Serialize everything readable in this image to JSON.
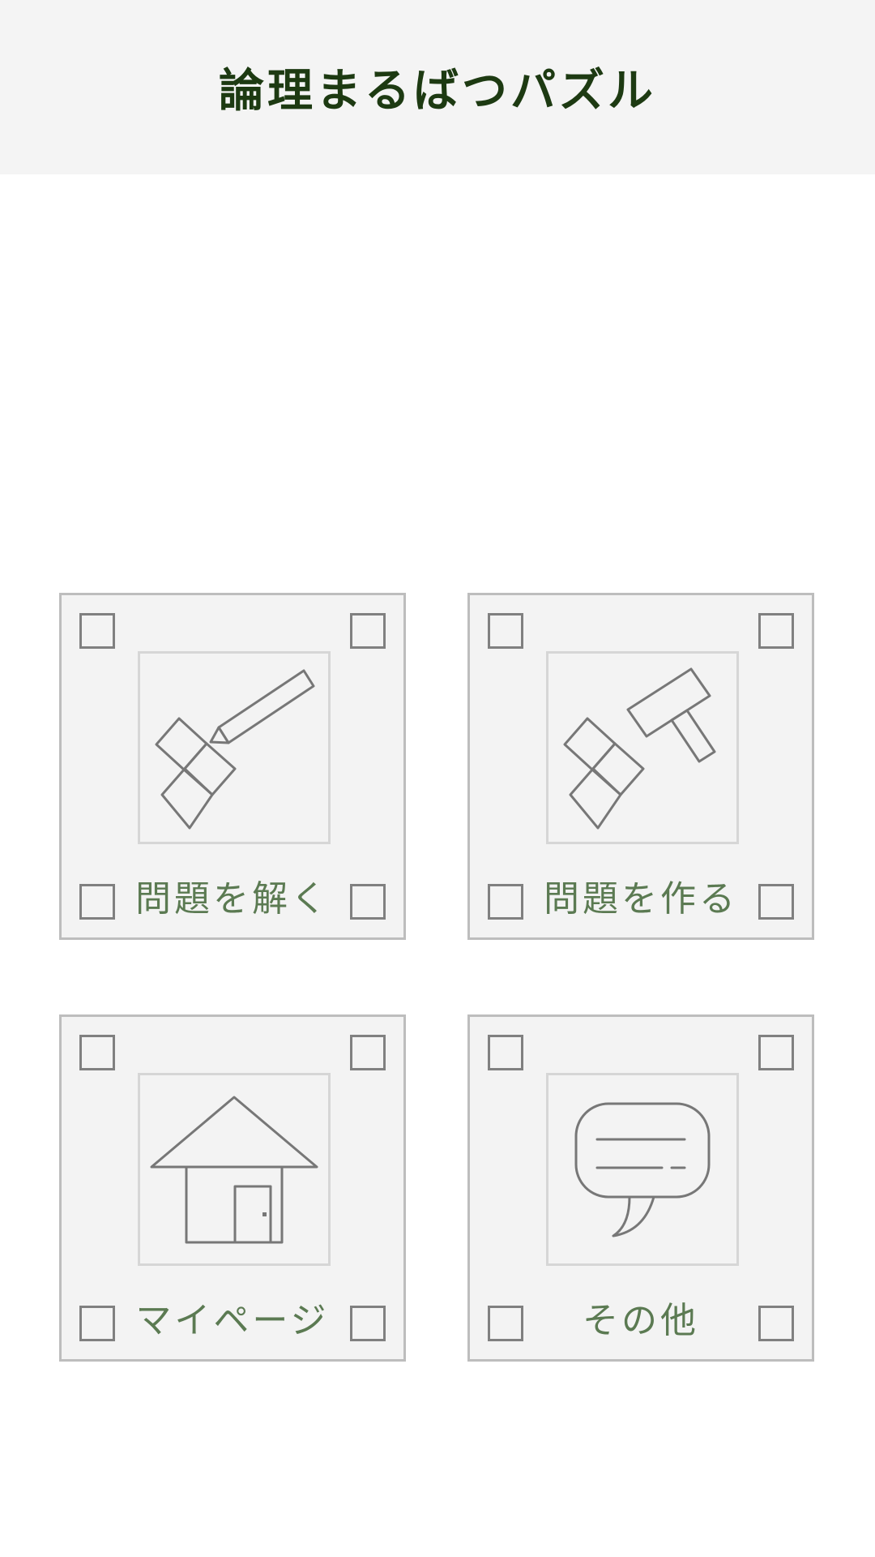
{
  "header": {
    "title": "論理まるばつパズル"
  },
  "menu": {
    "items": [
      {
        "label": "問題を解く",
        "icon": "pencil-blocks-icon"
      },
      {
        "label": "問題を作る",
        "icon": "hammer-blocks-icon"
      },
      {
        "label": "マイページ",
        "icon": "house-icon"
      },
      {
        "label": "その他",
        "icon": "speech-bubble-icon"
      }
    ]
  },
  "colors": {
    "header_bg": "#f4f4f4",
    "title": "#1d3a12",
    "card_bg": "#f3f3f3",
    "card_border": "#bdbdbd",
    "label": "#5b7a52",
    "icon_stroke": "#777777"
  }
}
